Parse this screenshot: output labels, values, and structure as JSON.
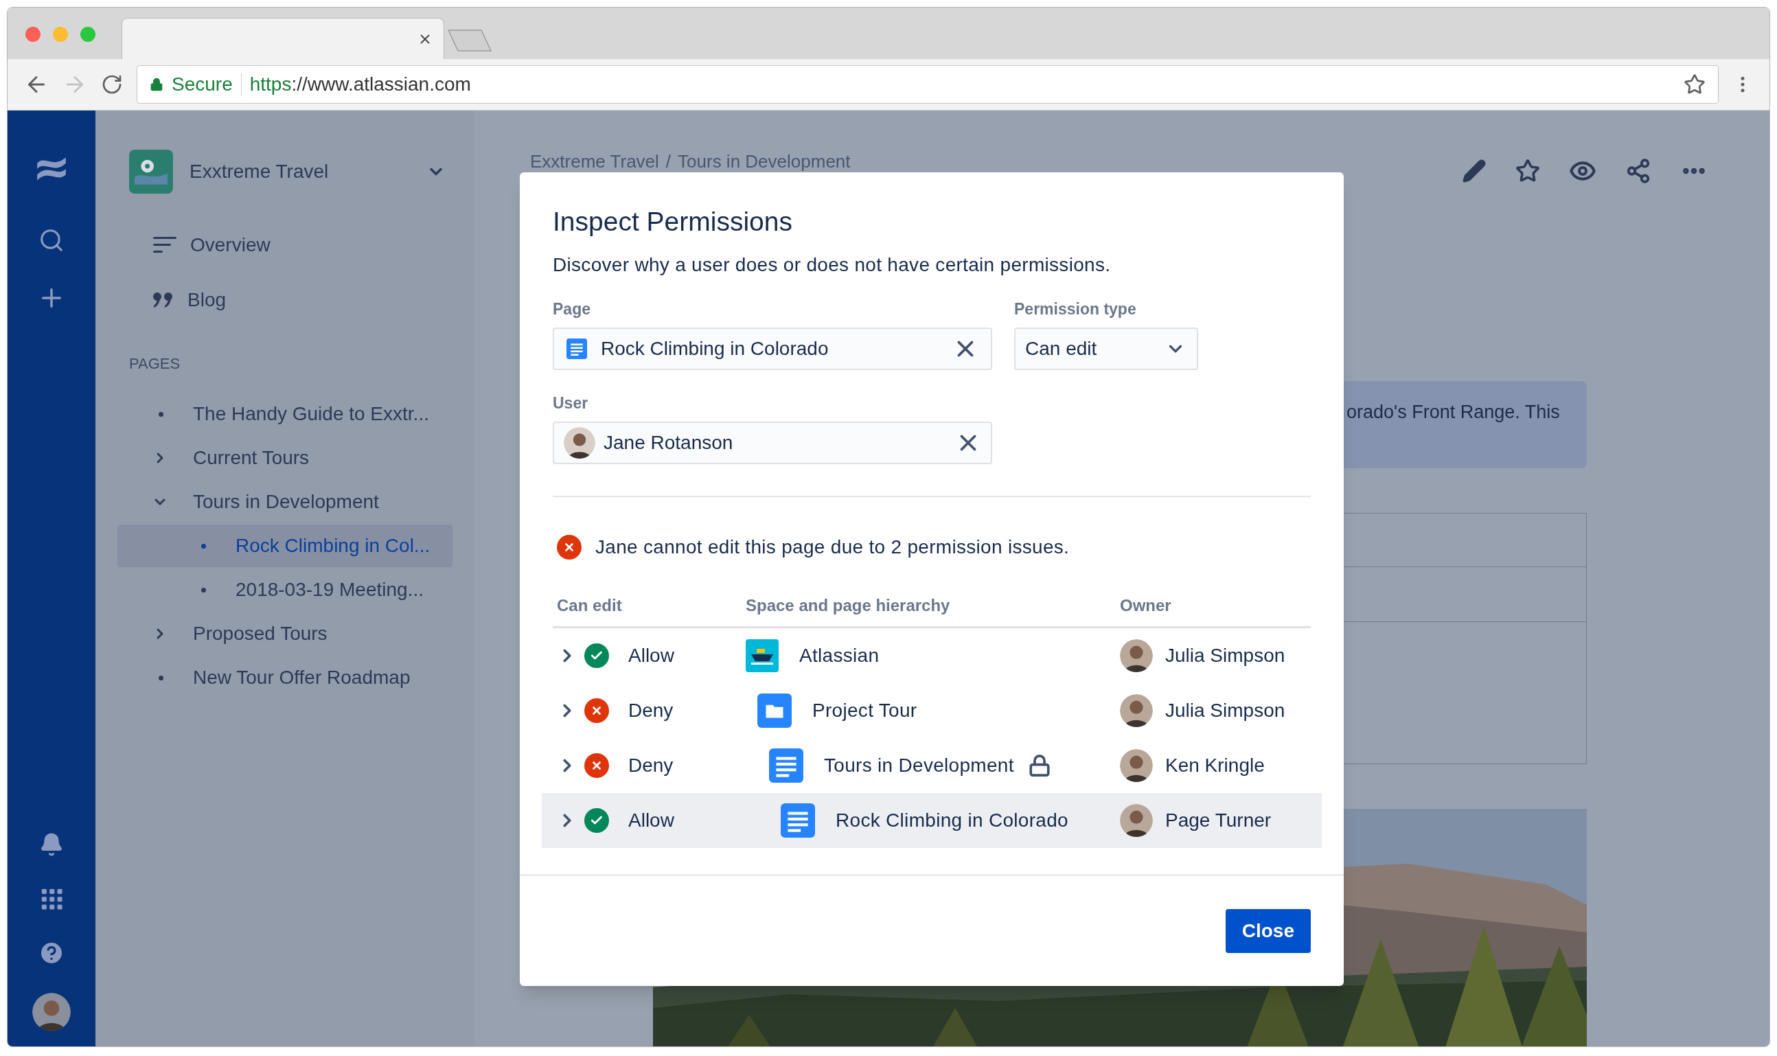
{
  "browser": {
    "security": "Secure",
    "url_scheme": "https",
    "url_rest": "://www.atlassian.com"
  },
  "space": {
    "name": "Exxtreme Travel"
  },
  "sidebar": {
    "items": [
      {
        "kind": "overview",
        "label": "Overview"
      },
      {
        "kind": "blog",
        "label": "Blog"
      }
    ],
    "section": "PAGES",
    "pages": [
      {
        "label": "The Handy Guide to Exxtr...",
        "selected": false
      },
      {
        "label": "Current Tours",
        "expanded": false,
        "selected": false
      },
      {
        "label": "Tours in Development",
        "expanded": true,
        "selected": false,
        "children": [
          {
            "label": "Rock Climbing in Col...",
            "selected": true
          },
          {
            "label": "2018-03-19 Meeting...",
            "selected": false
          }
        ]
      },
      {
        "label": "Proposed Tours",
        "expanded": false,
        "selected": false
      },
      {
        "label": "New Tour Offer Roadmap",
        "selected": false
      }
    ]
  },
  "breadcrumb": {
    "items": [
      "Exxtreme Travel",
      "Tours in Development"
    ],
    "separator": "/"
  },
  "content": {
    "panel_text": "orado's Front Range. This"
  },
  "dialog": {
    "title": "Inspect Permissions",
    "description": "Discover why a user does or does not have certain permissions.",
    "page_label": "Page",
    "page_value": "Rock Climbing in Colorado",
    "permission_label": "Permission type",
    "permission_value": "Can edit",
    "user_label": "User",
    "user_value": "Jane Rotanson",
    "message": "Jane cannot edit this page due to 2 permission issues.",
    "columns": [
      "Can edit",
      "Space and page hierarchy",
      "Owner"
    ],
    "rows": [
      {
        "allowed": true,
        "label": "Allow",
        "kind": "space",
        "name": "Atlassian",
        "restricted": false,
        "owner": "Julia Simpson",
        "expanded": false,
        "selected": false,
        "children": [
          {
            "allowed": false,
            "label": "Deny",
            "kind": "folder",
            "name": "Project Tour",
            "restricted": false,
            "owner": "Julia Simpson",
            "expanded": false,
            "selected": false,
            "children": [
              {
                "allowed": false,
                "label": "Deny",
                "kind": "page",
                "name": "Tours in Development",
                "restricted": true,
                "owner": "Ken Kringle",
                "expanded": false,
                "selected": false,
                "children": [
                  {
                    "allowed": true,
                    "label": "Allow",
                    "kind": "page",
                    "name": "Rock Climbing in Colorado",
                    "restricted": false,
                    "owner": "Page Turner",
                    "expanded": false,
                    "selected": true
                  }
                ]
              }
            ]
          }
        ]
      }
    ],
    "close": "Close"
  }
}
